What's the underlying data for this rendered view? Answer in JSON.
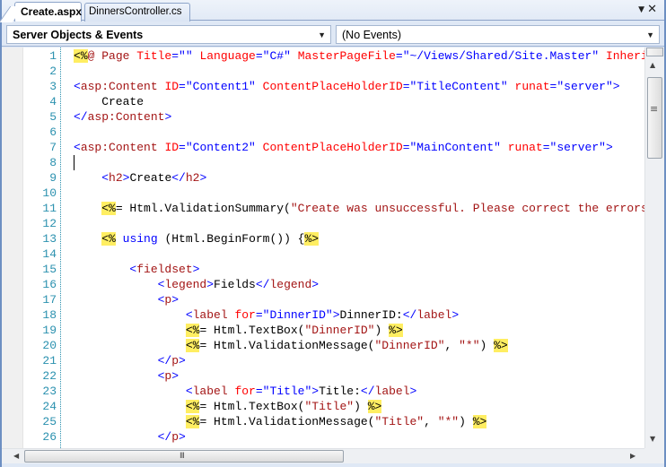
{
  "tabs": [
    {
      "label": "Create.aspx",
      "active": true
    },
    {
      "label": "DinnersController.cs",
      "active": false
    }
  ],
  "tab_controls": {
    "menu_icon": "dropdown-arrow-icon",
    "close_icon": "close-icon",
    "menu_glyph": "▼",
    "close_glyph": "✕"
  },
  "navbar": {
    "objects_dropdown": {
      "value": "Server Objects & Events"
    },
    "events_dropdown": {
      "value": "(No Events)"
    },
    "arrow_glyph": "▼"
  },
  "editor": {
    "caret_line": 8,
    "line_numbers": [
      "1",
      "2",
      "3",
      "4",
      "5",
      "6",
      "7",
      "8",
      "9",
      "10",
      "11",
      "12",
      "13",
      "14",
      "15",
      "16",
      "17",
      "18",
      "19",
      "20",
      "21",
      "22",
      "23",
      "24",
      "25",
      "26"
    ],
    "lines": [
      [
        {
          "t": "<%",
          "c": "hl"
        },
        {
          "t": "@ Page ",
          "c": "t-dir"
        },
        {
          "t": "Title",
          "c": "t-dirattr"
        },
        {
          "t": "=\"\" ",
          "c": "t-dirval"
        },
        {
          "t": "Language",
          "c": "t-dirattr"
        },
        {
          "t": "=\"C#\" ",
          "c": "t-dirval"
        },
        {
          "t": "MasterPageFile",
          "c": "t-dirattr"
        },
        {
          "t": "=\"~/Views/Shared/Site.Master\" ",
          "c": "t-dirval"
        },
        {
          "t": "Inherits",
          "c": "t-dirattr"
        }
      ],
      [],
      [
        {
          "t": "<",
          "c": "t-br"
        },
        {
          "t": "asp:Content",
          "c": "t-tag"
        },
        {
          "t": " ID",
          "c": "t-attr"
        },
        {
          "t": "=\"Content1\"",
          "c": "t-str"
        },
        {
          "t": " ContentPlaceHolderID",
          "c": "t-attr"
        },
        {
          "t": "=\"TitleContent\"",
          "c": "t-str"
        },
        {
          "t": " runat",
          "c": "t-attr"
        },
        {
          "t": "=\"server\"",
          "c": "t-str"
        },
        {
          "t": ">",
          "c": "t-br"
        }
      ],
      [
        {
          "t": "    Create",
          "c": ""
        }
      ],
      [
        {
          "t": "</",
          "c": "t-br"
        },
        {
          "t": "asp:Content",
          "c": "t-tag"
        },
        {
          "t": ">",
          "c": "t-br"
        }
      ],
      [],
      [
        {
          "t": "<",
          "c": "t-br"
        },
        {
          "t": "asp:Content",
          "c": "t-tag"
        },
        {
          "t": " ID",
          "c": "t-attr"
        },
        {
          "t": "=\"Content2\"",
          "c": "t-str"
        },
        {
          "t": " ContentPlaceHolderID",
          "c": "t-attr"
        },
        {
          "t": "=\"MainContent\"",
          "c": "t-str"
        },
        {
          "t": " runat",
          "c": "t-attr"
        },
        {
          "t": "=\"server\"",
          "c": "t-str"
        },
        {
          "t": ">",
          "c": "t-br"
        }
      ],
      [],
      [
        {
          "t": "    <",
          "c": "t-br"
        },
        {
          "t": "h2",
          "c": "t-tag"
        },
        {
          "t": ">",
          "c": "t-br"
        },
        {
          "t": "Create",
          "c": ""
        },
        {
          "t": "</",
          "c": "t-br"
        },
        {
          "t": "h2",
          "c": "t-tag"
        },
        {
          "t": ">",
          "c": "t-br"
        }
      ],
      [],
      [
        {
          "t": "    ",
          "c": ""
        },
        {
          "t": "<%",
          "c": "hl"
        },
        {
          "t": "= Html.ValidationSummary(",
          "c": ""
        },
        {
          "t": "\"Create was unsuccessful. Please correct the errors and try again.\"",
          "c": "t-cs-str"
        },
        {
          "t": ") ",
          "c": ""
        },
        {
          "t": "%>",
          "c": "hl"
        }
      ],
      [],
      [
        {
          "t": "    ",
          "c": ""
        },
        {
          "t": "<%",
          "c": "hl"
        },
        {
          "t": " ",
          "c": ""
        },
        {
          "t": "using",
          "c": "t-kw"
        },
        {
          "t": " (Html.BeginForm()) {",
          "c": ""
        },
        {
          "t": "%>",
          "c": "hl"
        }
      ],
      [],
      [
        {
          "t": "        <",
          "c": "t-br"
        },
        {
          "t": "fieldset",
          "c": "t-tag"
        },
        {
          "t": ">",
          "c": "t-br"
        }
      ],
      [
        {
          "t": "            <",
          "c": "t-br"
        },
        {
          "t": "legend",
          "c": "t-tag"
        },
        {
          "t": ">",
          "c": "t-br"
        },
        {
          "t": "Fields",
          "c": ""
        },
        {
          "t": "</",
          "c": "t-br"
        },
        {
          "t": "legend",
          "c": "t-tag"
        },
        {
          "t": ">",
          "c": "t-br"
        }
      ],
      [
        {
          "t": "            <",
          "c": "t-br"
        },
        {
          "t": "p",
          "c": "t-tag"
        },
        {
          "t": ">",
          "c": "t-br"
        }
      ],
      [
        {
          "t": "                <",
          "c": "t-br"
        },
        {
          "t": "label",
          "c": "t-tag"
        },
        {
          "t": " for",
          "c": "t-attr"
        },
        {
          "t": "=\"DinnerID\"",
          "c": "t-str"
        },
        {
          "t": ">",
          "c": "t-br"
        },
        {
          "t": "DinnerID:",
          "c": ""
        },
        {
          "t": "</",
          "c": "t-br"
        },
        {
          "t": "label",
          "c": "t-tag"
        },
        {
          "t": ">",
          "c": "t-br"
        }
      ],
      [
        {
          "t": "                ",
          "c": ""
        },
        {
          "t": "<%",
          "c": "hl"
        },
        {
          "t": "= Html.TextBox(",
          "c": ""
        },
        {
          "t": "\"DinnerID\"",
          "c": "t-cs-str"
        },
        {
          "t": ") ",
          "c": ""
        },
        {
          "t": "%>",
          "c": "hl"
        }
      ],
      [
        {
          "t": "                ",
          "c": ""
        },
        {
          "t": "<%",
          "c": "hl"
        },
        {
          "t": "= Html.ValidationMessage(",
          "c": ""
        },
        {
          "t": "\"DinnerID\"",
          "c": "t-cs-str"
        },
        {
          "t": ", ",
          "c": ""
        },
        {
          "t": "\"*\"",
          "c": "t-cs-str"
        },
        {
          "t": ") ",
          "c": ""
        },
        {
          "t": "%>",
          "c": "hl"
        }
      ],
      [
        {
          "t": "            </",
          "c": "t-br"
        },
        {
          "t": "p",
          "c": "t-tag"
        },
        {
          "t": ">",
          "c": "t-br"
        }
      ],
      [
        {
          "t": "            <",
          "c": "t-br"
        },
        {
          "t": "p",
          "c": "t-tag"
        },
        {
          "t": ">",
          "c": "t-br"
        }
      ],
      [
        {
          "t": "                <",
          "c": "t-br"
        },
        {
          "t": "label",
          "c": "t-tag"
        },
        {
          "t": " for",
          "c": "t-attr"
        },
        {
          "t": "=\"Title\"",
          "c": "t-str"
        },
        {
          "t": ">",
          "c": "t-br"
        },
        {
          "t": "Title:",
          "c": ""
        },
        {
          "t": "</",
          "c": "t-br"
        },
        {
          "t": "label",
          "c": "t-tag"
        },
        {
          "t": ">",
          "c": "t-br"
        }
      ],
      [
        {
          "t": "                ",
          "c": ""
        },
        {
          "t": "<%",
          "c": "hl"
        },
        {
          "t": "= Html.TextBox(",
          "c": ""
        },
        {
          "t": "\"Title\"",
          "c": "t-cs-str"
        },
        {
          "t": ") ",
          "c": ""
        },
        {
          "t": "%>",
          "c": "hl"
        }
      ],
      [
        {
          "t": "                ",
          "c": ""
        },
        {
          "t": "<%",
          "c": "hl"
        },
        {
          "t": "= Html.ValidationMessage(",
          "c": ""
        },
        {
          "t": "\"Title\"",
          "c": "t-cs-str"
        },
        {
          "t": ", ",
          "c": ""
        },
        {
          "t": "\"*\"",
          "c": "t-cs-str"
        },
        {
          "t": ") ",
          "c": ""
        },
        {
          "t": "%>",
          "c": "hl"
        }
      ],
      [
        {
          "t": "            </",
          "c": "t-br"
        },
        {
          "t": "p",
          "c": "t-tag"
        },
        {
          "t": ">",
          "c": "t-br"
        }
      ]
    ]
  },
  "scrollbars": {
    "vertical": {
      "up_glyph": "▲",
      "down_glyph": "▼",
      "grip_glyph": "≡"
    },
    "horizontal": {
      "left_glyph": "◀",
      "right_glyph": "▶",
      "grip_glyph": "III"
    }
  }
}
